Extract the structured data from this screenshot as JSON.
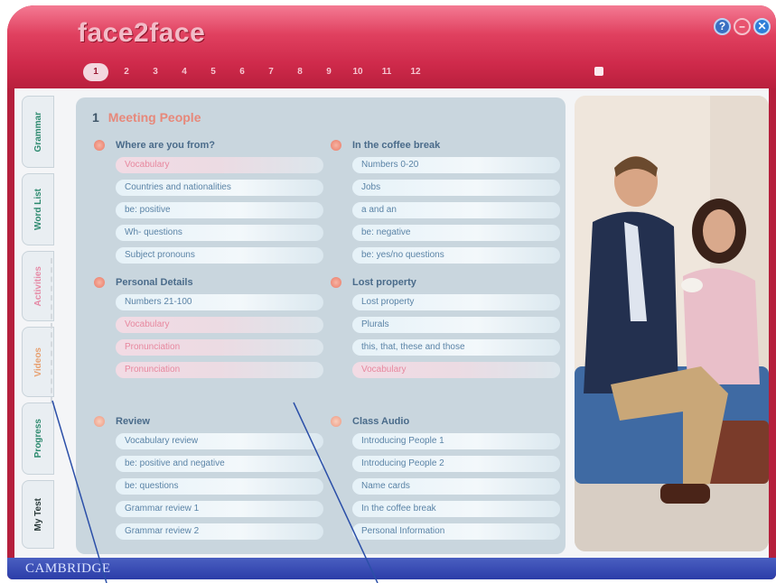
{
  "app": {
    "logo_text": "face2face"
  },
  "unit_tabs": [
    "1",
    "2",
    "3",
    "4",
    "5",
    "6",
    "7",
    "8",
    "9",
    "10",
    "11",
    "12"
  ],
  "window_buttons": {
    "help": "?",
    "minimize": "–",
    "close": "✕"
  },
  "side_tabs": [
    "Grammar",
    "Word List",
    "Activities",
    "Videos",
    "Progress",
    "My Test"
  ],
  "unit": {
    "number": "1",
    "title": "Meeting People"
  },
  "sections": [
    {
      "title": "Where are you from?",
      "items": [
        "Vocabulary",
        "Countries and nationalities",
        "be: positive",
        "Wh- questions",
        "Subject pronouns"
      ]
    },
    {
      "title": "In the coffee break",
      "items": [
        "Numbers 0-20",
        "Jobs",
        "a and an",
        "be: negative",
        "be: yes/no questions"
      ]
    },
    {
      "title": "Personal Details",
      "items": [
        "Numbers 21-100",
        "Vocabulary",
        "Pronunciation",
        "Pronunciation"
      ]
    },
    {
      "title": "Lost property",
      "items": [
        "Lost property",
        "Plurals",
        "this, that, these and those",
        "Vocabulary"
      ]
    },
    {
      "title": "Review",
      "items": [
        "Vocabulary review",
        "be: positive and negative",
        "be: questions",
        "Grammar review 1",
        "Grammar review 2"
      ]
    },
    {
      "title": "Class Audio",
      "items": [
        "Introducing People 1",
        "Introducing People 2",
        "Name cards",
        "In the coffee break",
        "Personal Information"
      ]
    }
  ],
  "footer": {
    "brand": "CAMBRIDGE"
  },
  "colors": {
    "header": "#cf2a4b",
    "footer": "#2b3da8",
    "panel": "#c9d6de"
  }
}
